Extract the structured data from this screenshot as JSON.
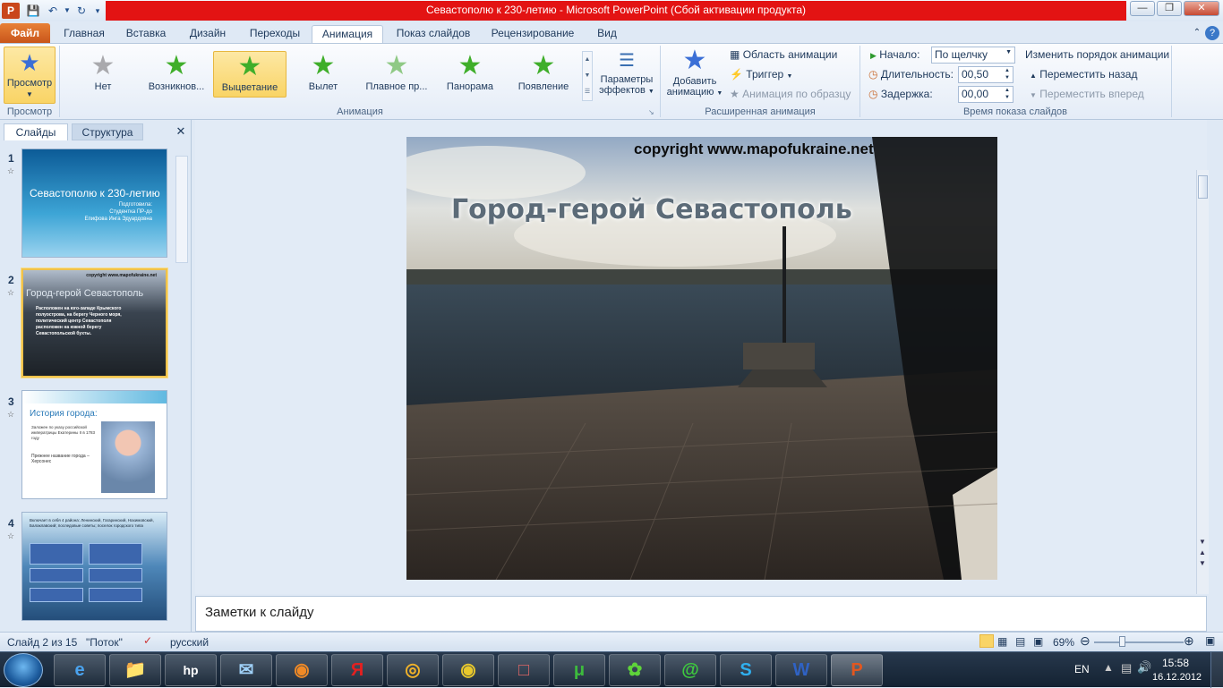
{
  "window": {
    "title": "Севастополю к 230-летию  -  Microsoft PowerPoint (Сбой активации продукта)"
  },
  "tabs": [
    "Файл",
    "Главная",
    "Вставка",
    "Дизайн",
    "Переходы",
    "Анимация",
    "Показ слайдов",
    "Рецензирование",
    "Вид"
  ],
  "active_tab": "Анимация",
  "ribbon": {
    "preview": {
      "label": "Просмотр",
      "group": "Просмотр"
    },
    "animation_group": "Анимация",
    "gallery": [
      "Нет",
      "Возникнов...",
      "Выцветание",
      "Вылет",
      "Плавное пр...",
      "Панорама",
      "Появление"
    ],
    "selected_effect": "Выцветание",
    "effect_params": {
      "line1": "Параметры",
      "line2": "эффектов"
    },
    "advanced": {
      "group": "Расширенная анимация",
      "add_line1": "Добавить",
      "add_line2": "анимацию",
      "pane": "Область анимации",
      "trigger": "Триггер",
      "painter": "Анимация по образцу"
    },
    "timing": {
      "group": "Время показа слайдов",
      "start_label": "Начало:",
      "start_value": "По щелчку",
      "duration_label": "Длительность:",
      "duration_value": "00,50",
      "delay_label": "Задержка:",
      "delay_value": "00,00",
      "reorder": "Изменить порядок анимации",
      "move_back": "Переместить назад",
      "move_forward": "Переместить вперед"
    }
  },
  "left_pane": {
    "tabs": [
      "Слайды",
      "Структура"
    ],
    "slides": [
      {
        "num": "1",
        "title": "Севастополю к 230-летию",
        "sub1": "Подготовила:",
        "sub2": "Студентка ПР-до",
        "sub3": "Епифова Инга Эдуардовна"
      },
      {
        "num": "2",
        "watermark": "copyright www.mapofukraine.net",
        "title": "Город-герой Севастополь",
        "body": "Расположен на юго-западе Крымского полуострова, на берегу Черного моря, политический центр Севастополя расположен на южной берегу Севастопольской бухты."
      },
      {
        "num": "3",
        "title": "История города:",
        "b1": "Заложен по указу российской императрицы Екатерины II в 1783 году",
        "b2": "Прежнее название города – Херсонес"
      },
      {
        "num": "4",
        "body": "Включает в себя 4 района: Ленинский, Гагаринский, Нахимовский, Балаклавский; последовые советы; поселок городского типа"
      }
    ]
  },
  "slide": {
    "watermark": "copyright www.mapofukraine.net",
    "title": "Город-герой Севастополь"
  },
  "notes_placeholder": "Заметки к слайду",
  "status": {
    "slide": "Слайд 2 из 15",
    "theme": "\"Поток\"",
    "lang": "русский",
    "zoom": "69%"
  },
  "taskbar": {
    "lang": "EN",
    "time": "15:58",
    "date": "16.12.2012"
  },
  "colors": {
    "titlebar_red": "#e31313",
    "file_tab": "#d96a27",
    "selected_gallery": "#f9d466"
  }
}
